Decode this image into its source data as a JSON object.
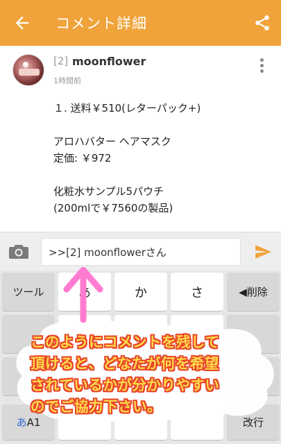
{
  "appbar": {
    "title": "コメント詳細",
    "back_icon": "arrow-left-icon",
    "share_icon": "share-icon",
    "color": "#f0a33a"
  },
  "comment": {
    "index": "[2]",
    "user": "moonflower",
    "time": "1時間前",
    "lines": [
      "１. 送料￥510(レターパック+)",
      "",
      "アロハバター ヘアマスク",
      "定価: ￥972",
      "",
      "化粧水サンプル5パウチ",
      "(200mlで￥7560の製品)"
    ]
  },
  "input": {
    "value": ">>[2] moonflowerさん",
    "camera_icon": "camera-icon",
    "send_icon": "send-icon",
    "accent": "#f0a33a"
  },
  "keyboard": {
    "row1": [
      "ツール",
      "あ",
      "か",
      "さ",
      "◀削除"
    ],
    "row4": [
      "あA1",
      "",
      "",
      "",
      "改行"
    ]
  },
  "annotation": {
    "lines": [
      "このようにコメントを残して",
      "頂けると、どなたが何を希望",
      "されているかが分かりやすい",
      "のでご協力下さい。"
    ],
    "text_color": "#ffd84a",
    "outline_color": "#e8462a",
    "arrow_color": "#ff7bd0"
  }
}
